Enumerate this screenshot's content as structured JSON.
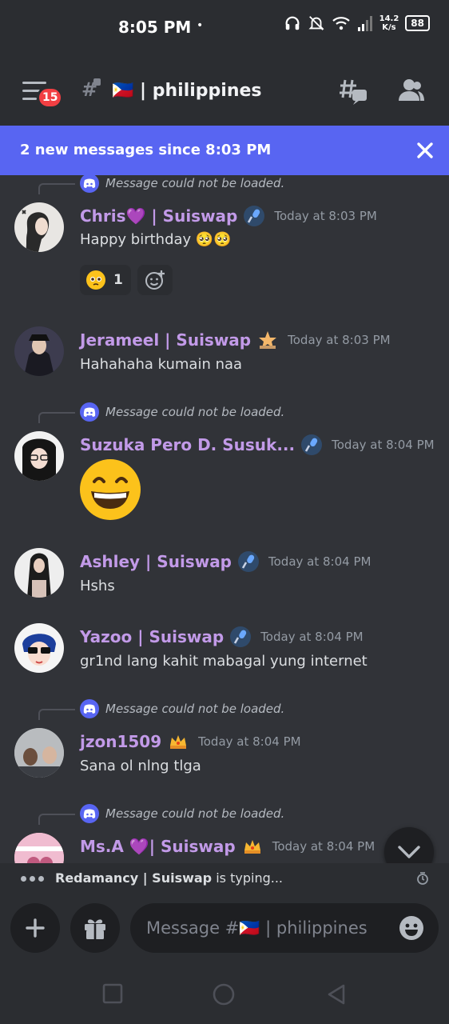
{
  "status_bar": {
    "time": "8:05 PM",
    "dot": "•",
    "speed_value": "14.2",
    "speed_unit": "K/s",
    "battery": "88"
  },
  "header": {
    "notification_count": "15",
    "channel_name": "🇵🇭 | philippines"
  },
  "banner": {
    "text": "2 new messages since 8:03 PM"
  },
  "reply_placeholder": "Message could not be loaded.",
  "messages": [
    {
      "username": "Chris💜 | Suiswap",
      "timestamp": "Today at 8:03 PM",
      "text": "Happy birthday 🥺🥺",
      "reaction_count": "1"
    },
    {
      "username": "Jerameel | Suiswap",
      "timestamp": "Today at 8:03 PM",
      "text": "Hahahaha kumain naa"
    },
    {
      "username": "Suzuka Pero D. Susuk...",
      "timestamp": "Today at 8:04 PM",
      "text": ""
    },
    {
      "username": "Ashley | Suiswap",
      "timestamp": "Today at 8:04 PM",
      "text": "Hshs"
    },
    {
      "username": "Yazoo | Suiswap",
      "timestamp": "Today at 8:04 PM",
      "text": "gr1nd lang kahit mabagal yung internet"
    },
    {
      "username": "jzon1509",
      "timestamp": "Today at 8:04 PM",
      "text": "Sana ol nlng tlga"
    },
    {
      "username": "Ms.A 💜| Suiswap",
      "timestamp": "Today at 8:04 PM",
      "text": ""
    }
  ],
  "typing": {
    "user": "Redamancy | Suiswap",
    "suffix": " is typing..."
  },
  "input": {
    "placeholder": "Message #🇵🇭 | philippines"
  },
  "colors": {
    "accent": "#5865f2",
    "username": "#c29ae8",
    "background": "#313338",
    "badge": "#f23f43"
  },
  "icons": [
    "headphones-icon",
    "mute-bell-icon",
    "wifi-icon",
    "signal-icon",
    "hamburger-icon",
    "threads-icon",
    "members-icon",
    "close-icon",
    "plus-icon",
    "gift-icon",
    "emoji-icon",
    "chevron-down-icon",
    "square-nav-icon",
    "circle-nav-icon",
    "back-nav-icon"
  ]
}
